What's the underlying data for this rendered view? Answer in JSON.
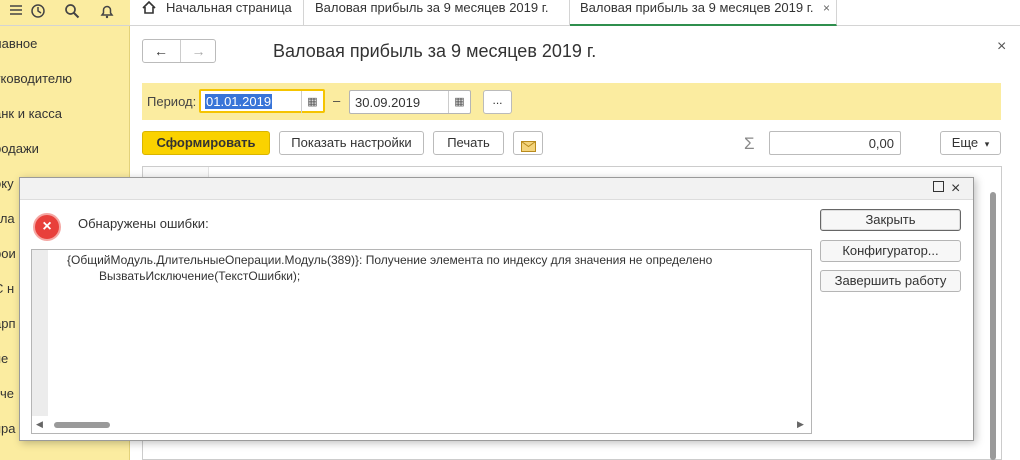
{
  "topbar": {
    "icons": [
      "menu-icon",
      "history-icon",
      "search-icon",
      "bell-icon"
    ],
    "tabs": [
      {
        "label": "Начальная страница",
        "icon": "home-icon"
      },
      {
        "label": "Валовая прибыль за 9 месяцев 2019 г."
      },
      {
        "label": "Валовая прибыль за 9 месяцев 2019 г.",
        "active": true,
        "close": "×"
      }
    ]
  },
  "sidebar": {
    "items": [
      "лавное",
      "уководителю",
      "анк и касса",
      "родажи",
      "оку",
      "кла",
      "рои",
      "С н",
      "арп",
      "пе",
      "тче",
      "пра"
    ]
  },
  "page": {
    "title": "Валовая прибыль за 9 месяцев 2019 г.",
    "close": "×",
    "nav_back": "←",
    "nav_forward": "→"
  },
  "period": {
    "label": "Период:",
    "from": "01.01.2019",
    "separator": "–",
    "to": "30.09.2019",
    "more": "..."
  },
  "toolbar": {
    "generate": "Сформировать",
    "show_settings": "Показать настройки",
    "print": "Печать",
    "sigma": "Σ",
    "sum": "0,00",
    "more": "Еще"
  },
  "dialog": {
    "title": "Обнаружены ошибки:",
    "error_icon": "×",
    "lines": [
      "{ОбщийМодуль.ДлительныеОперации.Модуль(389)}: Получение элемента по индексу для значения не определено",
      "ВызватьИсключение(ТекстОшибки);"
    ],
    "buttons": {
      "close": "Закрыть",
      "configurator": "Конфигуратор...",
      "exit": "Завершить работу"
    }
  },
  "colors": {
    "accent_yellow": "#fad200",
    "sidebar_bg": "#fbeca0",
    "active_tab_underline": "#2f8f4e",
    "error_red": "#e8403b"
  }
}
